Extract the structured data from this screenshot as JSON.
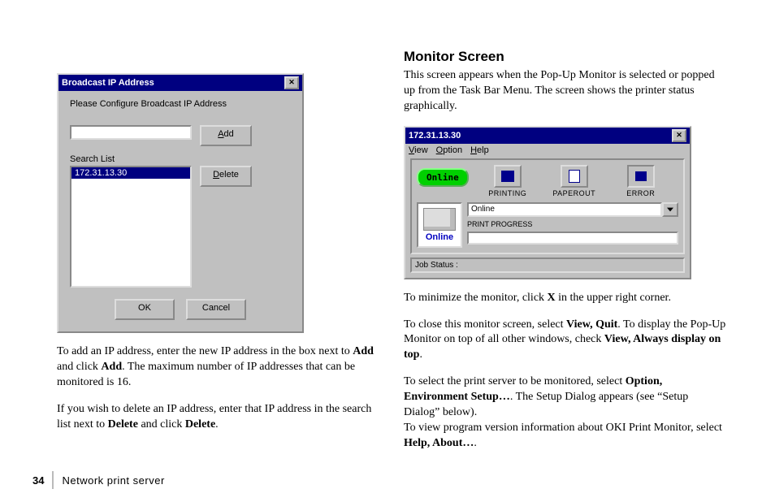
{
  "left": {
    "dialog1": {
      "title": "Broadcast IP Address",
      "instruction": "Please Configure Broadcast IP Address",
      "buttons": {
        "add": "Add",
        "delete": "Delete",
        "ok": "OK",
        "cancel": "Cancel"
      },
      "searchlist_label": "Search List",
      "selected_ip": "172.31.13.30"
    },
    "para1_pre": "To add an IP address, enter the new IP address in the box next to ",
    "para1_b1": "Add",
    "para1_mid": " and click ",
    "para1_b2": "Add",
    "para1_post": ".  The maximum number of IP addresses that can be monitored is 16.",
    "para2_pre": "If you wish to delete an IP address, enter that IP address in the search list next to ",
    "para2_b1": "Delete",
    "para2_mid": " and click ",
    "para2_b2": "Delete",
    "para2_post": "."
  },
  "right": {
    "heading": "Monitor Screen",
    "intro": "This screen appears when the Pop-Up Monitor is selected or popped up from the Task Bar Menu. The screen shows the printer status graphically.",
    "dialog2": {
      "title": "172.31.13.30",
      "menu": {
        "view": "View",
        "option": "Option",
        "help": "Help"
      },
      "online_btn": "Online",
      "stats": {
        "printing": "PRINTING",
        "paperout": "PAPEROUT",
        "error": "ERROR"
      },
      "printer_label": "Online",
      "combo_value": "Online",
      "print_progress_label": "PRINT PROGRESS",
      "job_status_label": "Job Status :"
    },
    "para3_pre": "To minimize the monitor, click ",
    "para3_b1": "X",
    "para3_post": " in the upper right corner.",
    "para4_pre": "To close this monitor screen, select ",
    "para4_b1": "View, Quit",
    "para4_mid": ". To display the Pop-Up Monitor on top of all other windows, check ",
    "para4_b2": "View, Always display on top",
    "para4_post": ".",
    "para5_pre": "To select the print server to be monitored, select ",
    "para5_b1": "Option, Environment Setup…",
    "para5_mid1": ". The Setup Dialog appears (see “Setup Dialog” below).",
    "para5_line2_pre": "To view program version information about OKI Print Monitor, select ",
    "para5_b2": "Help, About…",
    "para5_line2_post": "."
  },
  "footer": {
    "page": "34",
    "title": "Network print server"
  }
}
